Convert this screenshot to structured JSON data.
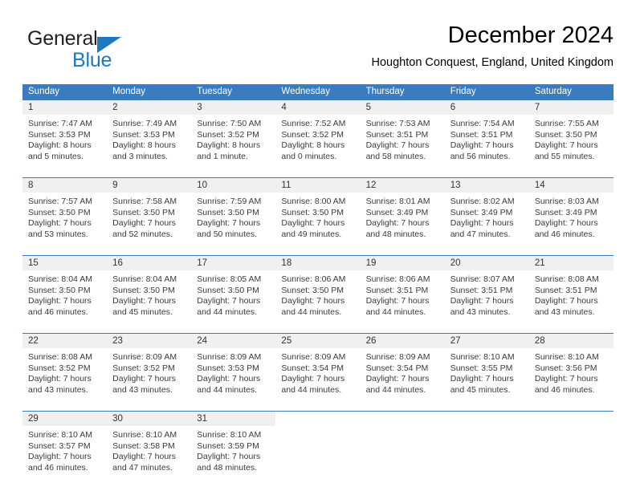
{
  "brand": {
    "name_top": "General",
    "name_bottom": "Blue",
    "color_dark": "#231f20",
    "color_blue": "#1b79bf"
  },
  "header": {
    "title": "December 2024",
    "subtitle": "Houghton Conquest, England, United Kingdom"
  },
  "theme": {
    "header_row_bg": "#3a7cbf",
    "header_row_text": "#ffffff",
    "day_number_bg": "#f0f0f0",
    "cell_text": "#3a3a3a"
  },
  "weekdays": [
    "Sunday",
    "Monday",
    "Tuesday",
    "Wednesday",
    "Thursday",
    "Friday",
    "Saturday"
  ],
  "weeks": [
    [
      {
        "day": "1",
        "sunrise": "Sunrise: 7:47 AM",
        "sunset": "Sunset: 3:53 PM",
        "daylight1": "Daylight: 8 hours",
        "daylight2": "and 5 minutes."
      },
      {
        "day": "2",
        "sunrise": "Sunrise: 7:49 AM",
        "sunset": "Sunset: 3:53 PM",
        "daylight1": "Daylight: 8 hours",
        "daylight2": "and 3 minutes."
      },
      {
        "day": "3",
        "sunrise": "Sunrise: 7:50 AM",
        "sunset": "Sunset: 3:52 PM",
        "daylight1": "Daylight: 8 hours",
        "daylight2": "and 1 minute."
      },
      {
        "day": "4",
        "sunrise": "Sunrise: 7:52 AM",
        "sunset": "Sunset: 3:52 PM",
        "daylight1": "Daylight: 8 hours",
        "daylight2": "and 0 minutes."
      },
      {
        "day": "5",
        "sunrise": "Sunrise: 7:53 AM",
        "sunset": "Sunset: 3:51 PM",
        "daylight1": "Daylight: 7 hours",
        "daylight2": "and 58 minutes."
      },
      {
        "day": "6",
        "sunrise": "Sunrise: 7:54 AM",
        "sunset": "Sunset: 3:51 PM",
        "daylight1": "Daylight: 7 hours",
        "daylight2": "and 56 minutes."
      },
      {
        "day": "7",
        "sunrise": "Sunrise: 7:55 AM",
        "sunset": "Sunset: 3:50 PM",
        "daylight1": "Daylight: 7 hours",
        "daylight2": "and 55 minutes."
      }
    ],
    [
      {
        "day": "8",
        "sunrise": "Sunrise: 7:57 AM",
        "sunset": "Sunset: 3:50 PM",
        "daylight1": "Daylight: 7 hours",
        "daylight2": "and 53 minutes."
      },
      {
        "day": "9",
        "sunrise": "Sunrise: 7:58 AM",
        "sunset": "Sunset: 3:50 PM",
        "daylight1": "Daylight: 7 hours",
        "daylight2": "and 52 minutes."
      },
      {
        "day": "10",
        "sunrise": "Sunrise: 7:59 AM",
        "sunset": "Sunset: 3:50 PM",
        "daylight1": "Daylight: 7 hours",
        "daylight2": "and 50 minutes."
      },
      {
        "day": "11",
        "sunrise": "Sunrise: 8:00 AM",
        "sunset": "Sunset: 3:50 PM",
        "daylight1": "Daylight: 7 hours",
        "daylight2": "and 49 minutes."
      },
      {
        "day": "12",
        "sunrise": "Sunrise: 8:01 AM",
        "sunset": "Sunset: 3:49 PM",
        "daylight1": "Daylight: 7 hours",
        "daylight2": "and 48 minutes."
      },
      {
        "day": "13",
        "sunrise": "Sunrise: 8:02 AM",
        "sunset": "Sunset: 3:49 PM",
        "daylight1": "Daylight: 7 hours",
        "daylight2": "and 47 minutes."
      },
      {
        "day": "14",
        "sunrise": "Sunrise: 8:03 AM",
        "sunset": "Sunset: 3:49 PM",
        "daylight1": "Daylight: 7 hours",
        "daylight2": "and 46 minutes."
      }
    ],
    [
      {
        "day": "15",
        "sunrise": "Sunrise: 8:04 AM",
        "sunset": "Sunset: 3:50 PM",
        "daylight1": "Daylight: 7 hours",
        "daylight2": "and 46 minutes."
      },
      {
        "day": "16",
        "sunrise": "Sunrise: 8:04 AM",
        "sunset": "Sunset: 3:50 PM",
        "daylight1": "Daylight: 7 hours",
        "daylight2": "and 45 minutes."
      },
      {
        "day": "17",
        "sunrise": "Sunrise: 8:05 AM",
        "sunset": "Sunset: 3:50 PM",
        "daylight1": "Daylight: 7 hours",
        "daylight2": "and 44 minutes."
      },
      {
        "day": "18",
        "sunrise": "Sunrise: 8:06 AM",
        "sunset": "Sunset: 3:50 PM",
        "daylight1": "Daylight: 7 hours",
        "daylight2": "and 44 minutes."
      },
      {
        "day": "19",
        "sunrise": "Sunrise: 8:06 AM",
        "sunset": "Sunset: 3:51 PM",
        "daylight1": "Daylight: 7 hours",
        "daylight2": "and 44 minutes."
      },
      {
        "day": "20",
        "sunrise": "Sunrise: 8:07 AM",
        "sunset": "Sunset: 3:51 PM",
        "daylight1": "Daylight: 7 hours",
        "daylight2": "and 43 minutes."
      },
      {
        "day": "21",
        "sunrise": "Sunrise: 8:08 AM",
        "sunset": "Sunset: 3:51 PM",
        "daylight1": "Daylight: 7 hours",
        "daylight2": "and 43 minutes."
      }
    ],
    [
      {
        "day": "22",
        "sunrise": "Sunrise: 8:08 AM",
        "sunset": "Sunset: 3:52 PM",
        "daylight1": "Daylight: 7 hours",
        "daylight2": "and 43 minutes."
      },
      {
        "day": "23",
        "sunrise": "Sunrise: 8:09 AM",
        "sunset": "Sunset: 3:52 PM",
        "daylight1": "Daylight: 7 hours",
        "daylight2": "and 43 minutes."
      },
      {
        "day": "24",
        "sunrise": "Sunrise: 8:09 AM",
        "sunset": "Sunset: 3:53 PM",
        "daylight1": "Daylight: 7 hours",
        "daylight2": "and 44 minutes."
      },
      {
        "day": "25",
        "sunrise": "Sunrise: 8:09 AM",
        "sunset": "Sunset: 3:54 PM",
        "daylight1": "Daylight: 7 hours",
        "daylight2": "and 44 minutes."
      },
      {
        "day": "26",
        "sunrise": "Sunrise: 8:09 AM",
        "sunset": "Sunset: 3:54 PM",
        "daylight1": "Daylight: 7 hours",
        "daylight2": "and 44 minutes."
      },
      {
        "day": "27",
        "sunrise": "Sunrise: 8:10 AM",
        "sunset": "Sunset: 3:55 PM",
        "daylight1": "Daylight: 7 hours",
        "daylight2": "and 45 minutes."
      },
      {
        "day": "28",
        "sunrise": "Sunrise: 8:10 AM",
        "sunset": "Sunset: 3:56 PM",
        "daylight1": "Daylight: 7 hours",
        "daylight2": "and 46 minutes."
      }
    ],
    [
      {
        "day": "29",
        "sunrise": "Sunrise: 8:10 AM",
        "sunset": "Sunset: 3:57 PM",
        "daylight1": "Daylight: 7 hours",
        "daylight2": "and 46 minutes."
      },
      {
        "day": "30",
        "sunrise": "Sunrise: 8:10 AM",
        "sunset": "Sunset: 3:58 PM",
        "daylight1": "Daylight: 7 hours",
        "daylight2": "and 47 minutes."
      },
      {
        "day": "31",
        "sunrise": "Sunrise: 8:10 AM",
        "sunset": "Sunset: 3:59 PM",
        "daylight1": "Daylight: 7 hours",
        "daylight2": "and 48 minutes."
      },
      {
        "day": "",
        "sunrise": "",
        "sunset": "",
        "daylight1": "",
        "daylight2": ""
      },
      {
        "day": "",
        "sunrise": "",
        "sunset": "",
        "daylight1": "",
        "daylight2": ""
      },
      {
        "day": "",
        "sunrise": "",
        "sunset": "",
        "daylight1": "",
        "daylight2": ""
      },
      {
        "day": "",
        "sunrise": "",
        "sunset": "",
        "daylight1": "",
        "daylight2": ""
      }
    ]
  ]
}
